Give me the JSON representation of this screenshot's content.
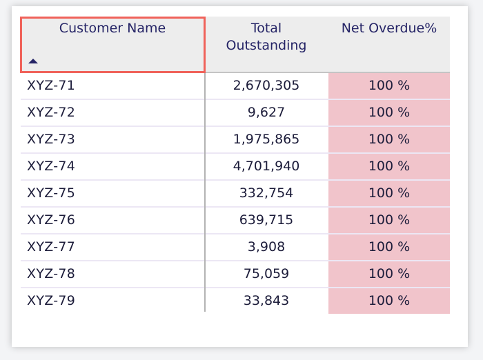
{
  "table": {
    "columns": {
      "customer_name": "Customer Name",
      "total_outstanding_line1": "Total",
      "total_outstanding_line2": "Outstanding",
      "net_overdue": "Net Overdue%"
    },
    "sort": "ascending",
    "rows": [
      {
        "name": "XYZ-71",
        "total": "2,670,305",
        "overdue": "100 %"
      },
      {
        "name": "XYZ-72",
        "total": "9,627",
        "overdue": "100 %"
      },
      {
        "name": "XYZ-73",
        "total": "1,975,865",
        "overdue": "100 %"
      },
      {
        "name": "XYZ-74",
        "total": "4,701,940",
        "overdue": "100 %"
      },
      {
        "name": "XYZ-75",
        "total": "332,754",
        "overdue": "100 %"
      },
      {
        "name": "XYZ-76",
        "total": "639,715",
        "overdue": "100 %"
      },
      {
        "name": "XYZ-77",
        "total": "3,908",
        "overdue": "100 %"
      },
      {
        "name": "XYZ-78",
        "total": "75,059",
        "overdue": "100 %"
      },
      {
        "name": "XYZ-79",
        "total": "33,843",
        "overdue": "100 %"
      }
    ]
  },
  "colors": {
    "header_text": "#252466",
    "overdue_fill": "#f1c4cb",
    "highlight_border": "#f0625a"
  }
}
